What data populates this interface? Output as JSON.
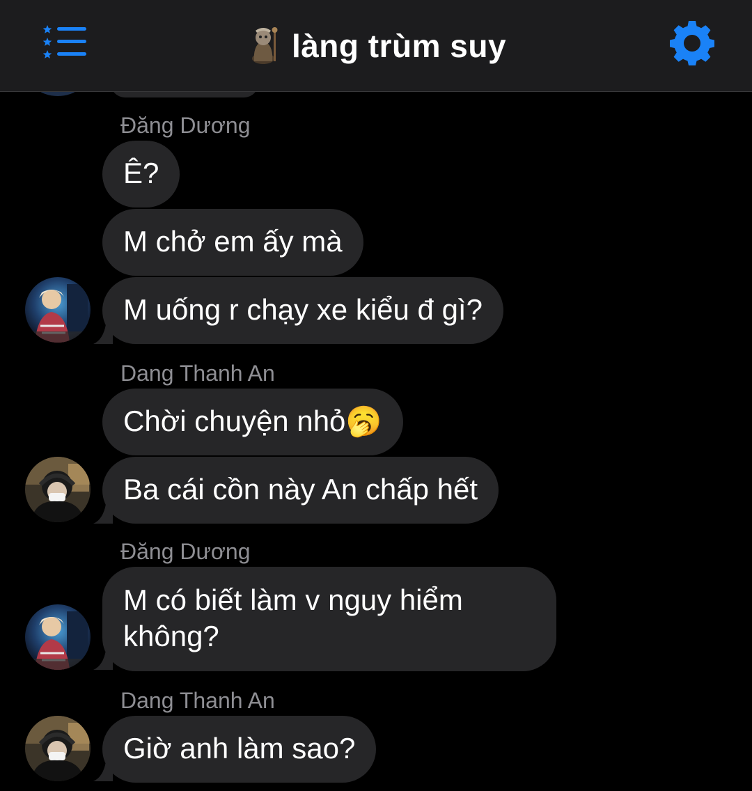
{
  "header": {
    "title": "làng trùm suy",
    "accent_color": "#1a82f7",
    "menu_icon": "list-star-icon",
    "settings_icon": "gear-icon",
    "group_icon": "group-avatar-icon"
  },
  "messages": [
    {
      "sender": "Đăng Dương",
      "bubbles": [
        "Ê?",
        "M chở em ấy mà",
        "M uống r chạy xe kiểu đ gì?"
      ]
    },
    {
      "sender": "Dang Thanh An",
      "bubbles": [
        "Chời chuyện nhỏ🥱",
        "Ba cái cồn này An chấp hết"
      ]
    },
    {
      "sender": "Đăng Dương",
      "bubbles": [
        "M có biết làm v nguy hiểm không?"
      ]
    },
    {
      "sender": "Dang Thanh An",
      "bubbles": [
        "Giờ anh làm sao?"
      ]
    }
  ]
}
